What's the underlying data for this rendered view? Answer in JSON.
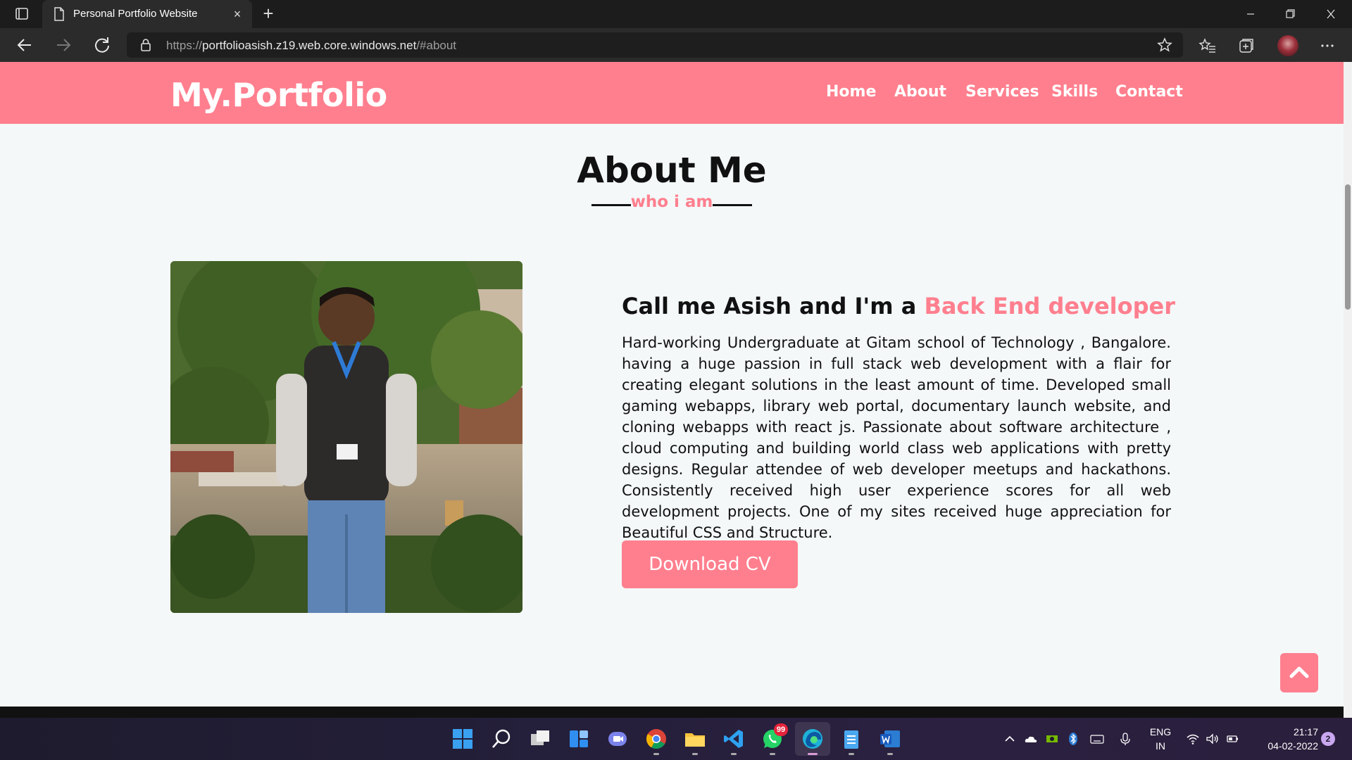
{
  "browser": {
    "tab_title": "Personal Portfolio Website",
    "tab_close_glyph": "×",
    "new_tab_glyph": "+",
    "url_scheme": "https://",
    "url_host": "portfolioasish.z19.web.core.windows.net",
    "url_path": "/#about"
  },
  "site": {
    "logo": "My.Portfolio",
    "nav": [
      "Home",
      "About",
      "Services",
      "Skills",
      "Contact"
    ],
    "accent_color": "#ff7f8e"
  },
  "about": {
    "title": "About Me",
    "subtitle": "who i am",
    "heading_prefix": "Call me Asish and I'm a ",
    "heading_accent": "Back End developer",
    "paragraph": "Hard-working Undergraduate at Gitam school of Technology , Bangalore. having a huge passion in full stack web development with a flair for creating elegant solutions in the least amount of time. Developed small gaming webapps, library web portal, documentary launch website, and cloning webapps with react js. Passionate about software architecture , cloud computing and building world class web applications with pretty designs. Regular attendee of web developer meetups and hackathons. Consistently received high user experience scores for all web development projects. One of my sites received huge appreciation for Beautiful CSS and Structure.",
    "button": "Download CV"
  },
  "taskbar": {
    "whatsapp_badge": "99",
    "lang_line1": "ENG",
    "lang_line2": "IN",
    "time": "21:17",
    "date": "04-02-2022",
    "notifications": "2"
  }
}
